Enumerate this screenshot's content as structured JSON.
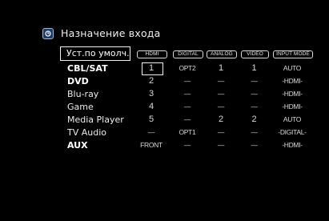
{
  "header": {
    "title": "Назначение входа",
    "icon": "input-assign-icon"
  },
  "defaults_button": {
    "label": "Уст.по умолч."
  },
  "columns": [
    "HDMI",
    "DIGITAL",
    "ANALOG",
    "VIDEO",
    "INPUT MODE"
  ],
  "rows": [
    {
      "label": "CBL/SAT",
      "bold": true,
      "cells": [
        "1",
        "OPT2",
        "1",
        "1",
        "AUTO"
      ]
    },
    {
      "label": "DVD",
      "bold": true,
      "cells": [
        "2",
        "—",
        "—",
        "—",
        "-HDMI-"
      ]
    },
    {
      "label": "Blu-ray",
      "bold": false,
      "cells": [
        "3",
        "—",
        "—",
        "—",
        "-HDMI-"
      ]
    },
    {
      "label": "Game",
      "bold": false,
      "cells": [
        "4",
        "—",
        "—",
        "—",
        "-HDMI-"
      ]
    },
    {
      "label": "Media Player",
      "bold": false,
      "cells": [
        "5",
        "—",
        "2",
        "2",
        "AUTO"
      ]
    },
    {
      "label": "TV Audio",
      "bold": false,
      "cells": [
        "—",
        "OPT1",
        "—",
        "—",
        "-DIGITAL-"
      ]
    },
    {
      "label": "AUX",
      "bold": true,
      "cells": [
        "FRONT",
        "—",
        "—",
        "—",
        "-HDMI-"
      ]
    }
  ]
}
